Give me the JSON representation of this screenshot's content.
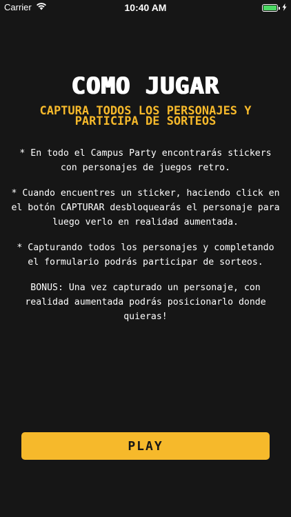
{
  "status_bar": {
    "carrier": "Carrier",
    "time": "10:40 AM",
    "icons": [
      "wifi-icon",
      "battery-icon",
      "charging-bolt-icon"
    ],
    "battery_level": 1.0,
    "battery_color": "#4cd964"
  },
  "content": {
    "title": "COMO JUGAR",
    "subtitle": "CAPTURA TODOS LOS PERSONAJES Y PARTICIPA DE SORTEOS",
    "paragraphs": [
      "* En todo el Campus Party encontrarás stickers con personajes de juegos retro.",
      "* Cuando encuentres un sticker, haciendo click en el botón CAPTURAR desbloquearás el personaje para luego verlo en realidad aumentada.",
      "* Capturando todos los personajes y completando el formulario podrás participar de sorteos.",
      "BONUS: Una vez capturado un personaje, con realidad aumentada podrás posicionarlo donde quieras!"
    ]
  },
  "play_button": {
    "label": "PLAY"
  },
  "colors": {
    "background": "#161616",
    "accent": "#f6b92b",
    "text": "#ffffff"
  }
}
